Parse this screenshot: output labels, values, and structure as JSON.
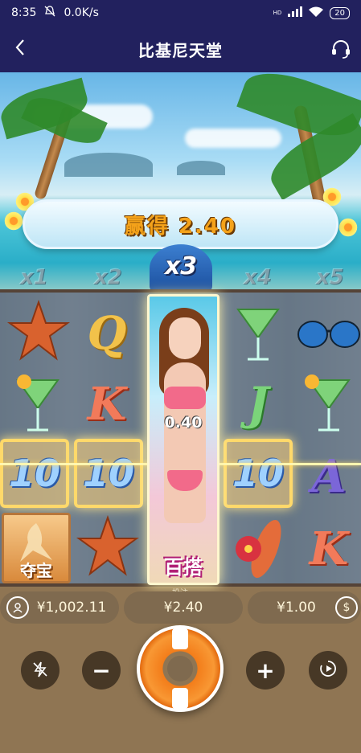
{
  "status": {
    "time": "8:35",
    "net_speed": "0.0K/s",
    "net_type": "HD",
    "battery": "20",
    "icons": [
      "mute-bell-icon",
      "signal-icon",
      "wifi-icon",
      "battery-icon"
    ]
  },
  "header": {
    "title": "比基尼天堂",
    "back_icon": "back-chevron-icon",
    "support_icon": "headset-icon"
  },
  "game": {
    "win_text": "赢得 2.40",
    "current_multiplier": "x3",
    "multipliers": [
      "x1",
      "x2",
      "x3",
      "x4",
      "x5"
    ],
    "featured_value": "0.40",
    "wild_label": "百搭",
    "scatter_label": "夺宝",
    "reel_symbols": [
      [
        "starfish",
        "cocktail",
        "10",
        "scatter"
      ],
      [
        "Q",
        "K",
        "10",
        "starfish"
      ],
      [
        "wild-girl"
      ],
      [
        "cocktail",
        "J",
        "10",
        "flower-surfboard"
      ],
      [
        "sunglasses",
        "cocktail",
        "A",
        "K"
      ]
    ],
    "winning_symbol": "10"
  },
  "info": {
    "balance": "¥1,002.11",
    "bet_caption": "投注",
    "win": "¥2.40",
    "bet": "¥1.00"
  },
  "controls": {
    "turbo_icon": "lightning-off-icon",
    "minus_icon": "minus-icon",
    "spin_icon": "life-ring-spin-icon",
    "plus_icon": "plus-icon",
    "autoplay_icon": "autoplay-icon",
    "minus_label": "−",
    "plus_label": "+"
  },
  "colors": {
    "header_bg": "#22215e",
    "win_gold": "#f4a21a",
    "pill_bg": "#7f6a4f",
    "spin_orange": "#f37d1a"
  }
}
